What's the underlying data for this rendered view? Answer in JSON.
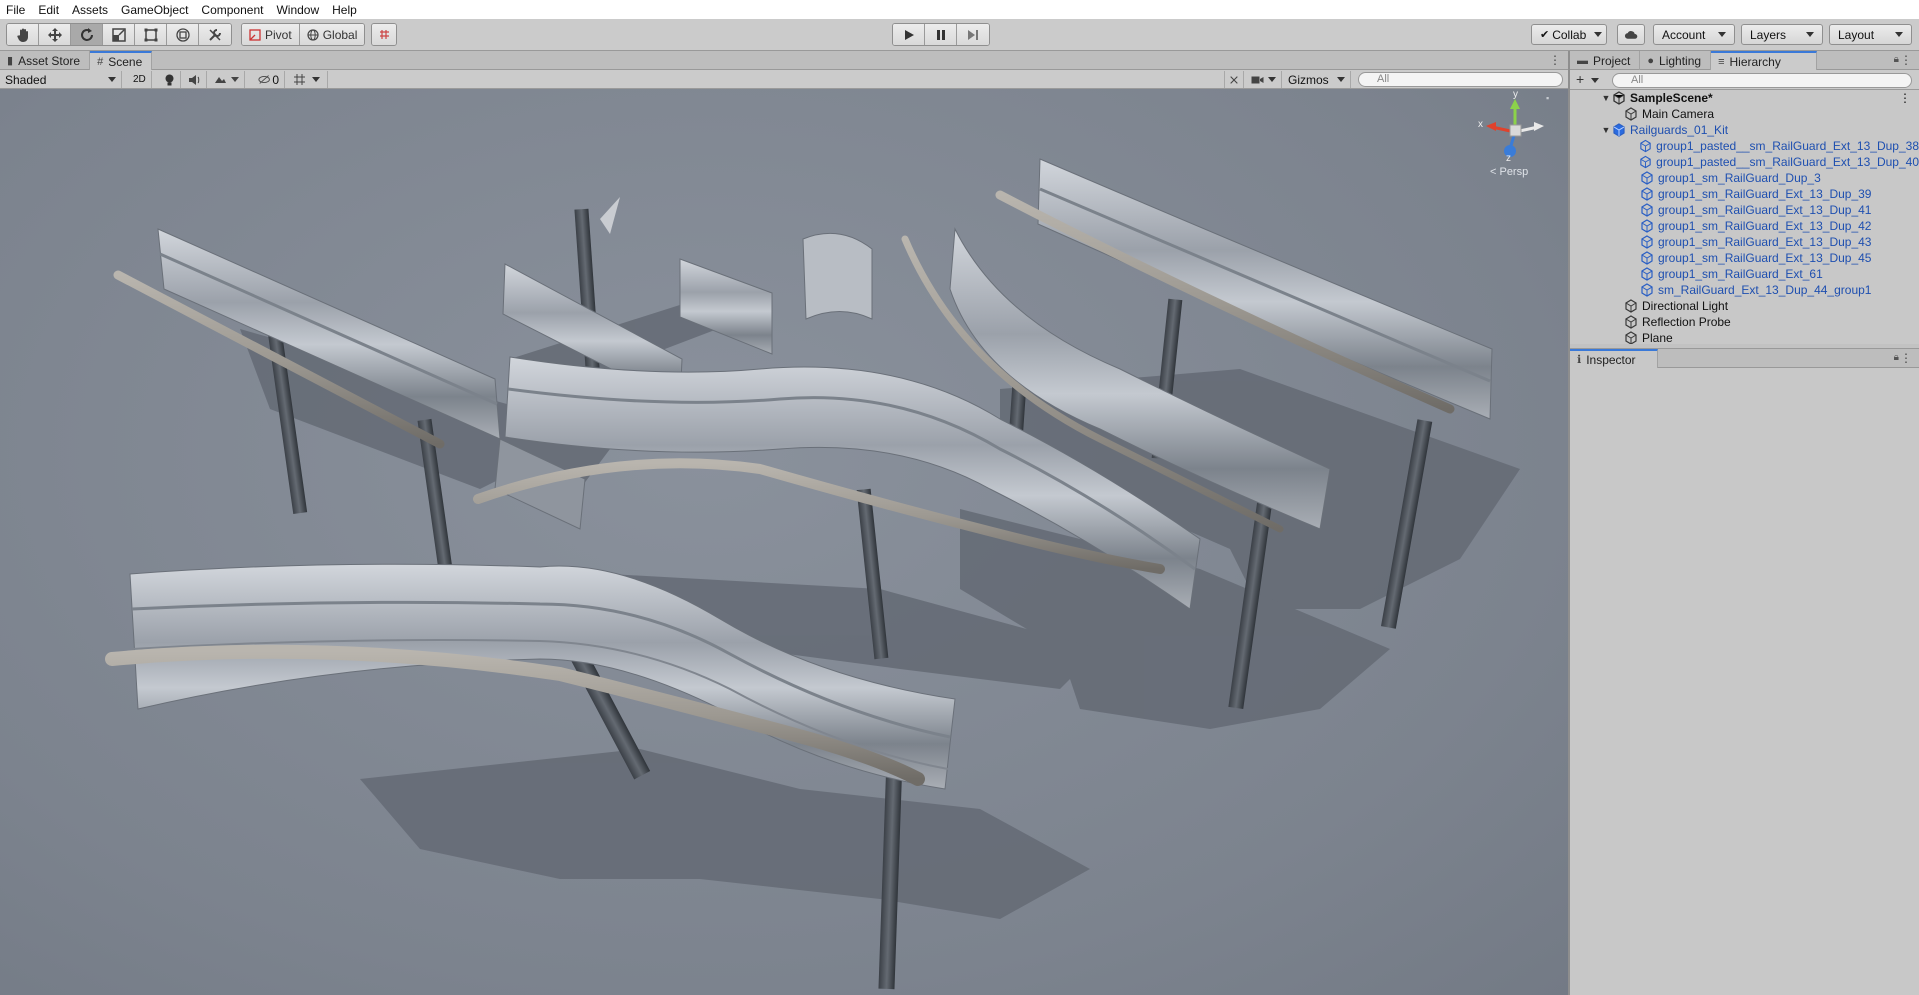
{
  "menu": [
    "File",
    "Edit",
    "Assets",
    "GameObject",
    "Component",
    "Window",
    "Help"
  ],
  "toolbar": {
    "tools": [
      "hand-tool",
      "move-tool",
      "rotate-tool",
      "scale-tool",
      "rect-tool",
      "transform-tool",
      "custom-tool"
    ],
    "pivot_label": "Pivot",
    "global_label": "Global",
    "collab_label": "Collab",
    "account_label": "Account",
    "layers_label": "Layers",
    "layout_label": "Layout"
  },
  "scene_tabs": {
    "asset_store": "Asset Store",
    "scene": "Scene"
  },
  "scene_toolbar": {
    "draw_mode": "Shaded",
    "mode_2d": "2D",
    "hidden_count": "0",
    "gizmos_label": "Gizmos",
    "search_placeholder": "All"
  },
  "gizmo": {
    "y": "y",
    "x": "x",
    "z": "z",
    "persp_label": "< Persp"
  },
  "side_tabs": {
    "project": "Project",
    "lighting": "Lighting",
    "hierarchy": "Hierarchy"
  },
  "hierarchy": {
    "search_placeholder": "All",
    "scene_name": "SampleScene*",
    "items": [
      {
        "label": "Main Camera",
        "level": 1,
        "prefab": false
      },
      {
        "label": "Railguards_01_Kit",
        "level": 1,
        "prefab": true,
        "expanded": true
      },
      {
        "label": "group1_pasted__sm_RailGuard_Ext_13_Dup_38",
        "level": 2,
        "prefab": true
      },
      {
        "label": "group1_pasted__sm_RailGuard_Ext_13_Dup_40",
        "level": 2,
        "prefab": true
      },
      {
        "label": "group1_sm_RailGuard_Dup_3",
        "level": 2,
        "prefab": true
      },
      {
        "label": "group1_sm_RailGuard_Ext_13_Dup_39",
        "level": 2,
        "prefab": true
      },
      {
        "label": "group1_sm_RailGuard_Ext_13_Dup_41",
        "level": 2,
        "prefab": true
      },
      {
        "label": "group1_sm_RailGuard_Ext_13_Dup_42",
        "level": 2,
        "prefab": true
      },
      {
        "label": "group1_sm_RailGuard_Ext_13_Dup_43",
        "level": 2,
        "prefab": true
      },
      {
        "label": "group1_sm_RailGuard_Ext_13_Dup_45",
        "level": 2,
        "prefab": true
      },
      {
        "label": "group1_sm_RailGuard_Ext_61",
        "level": 2,
        "prefab": true
      },
      {
        "label": "sm_RailGuard_Ext_13_Dup_44_group1",
        "level": 2,
        "prefab": true
      },
      {
        "label": "Directional Light",
        "level": 1,
        "prefab": false
      },
      {
        "label": "Reflection Probe",
        "level": 1,
        "prefab": false
      },
      {
        "label": "Plane",
        "level": 1,
        "prefab": false
      }
    ]
  },
  "inspector": {
    "tab_label": "Inspector"
  },
  "colors": {
    "accent": "#3a79d8",
    "prefab_text": "#1e4fb0",
    "viewport_bg": "#7f8691",
    "rail_light": "#c3c8cf",
    "rail_dark": "#6d737b",
    "post": "#4a4f57",
    "shadow": "#5d636c"
  }
}
